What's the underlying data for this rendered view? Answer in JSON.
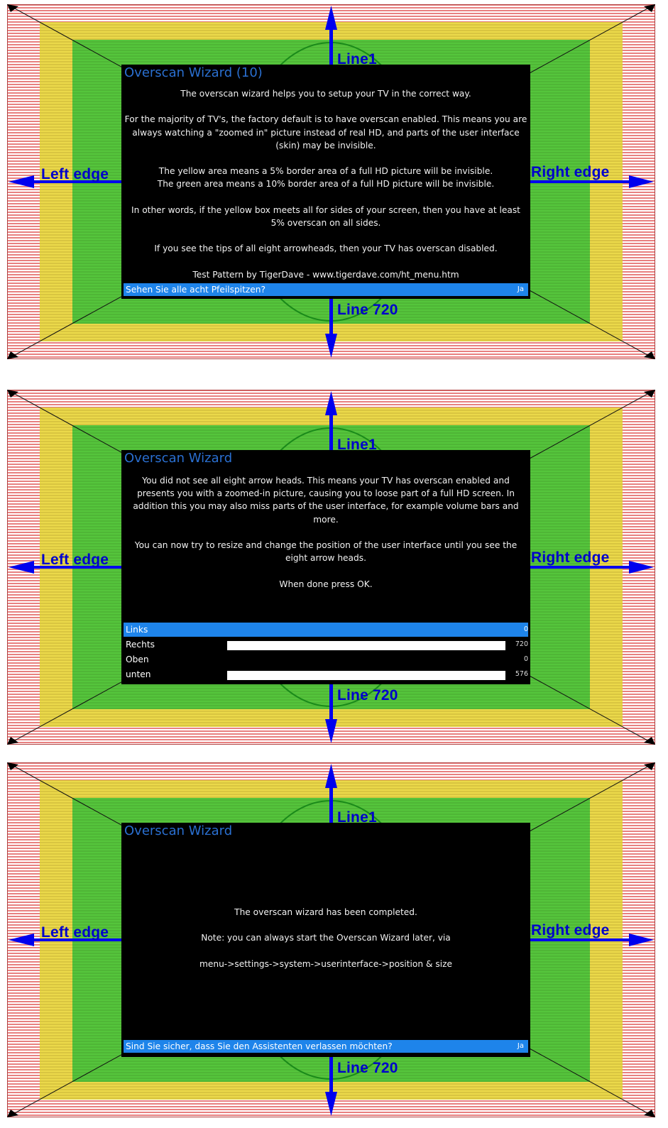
{
  "pattern": {
    "colors": {
      "red_stripes": "#e88080",
      "yellow": "#ebd94a",
      "green": "#55c53c",
      "arrow": "#0000ee"
    },
    "labels": {
      "top": "Line1",
      "bottom": "Line 720",
      "left": "Left edge",
      "right": "Right edge"
    }
  },
  "screens": [
    {
      "title": "Overscan Wizard (10)",
      "body": [
        "The overscan wizard helps you to setup your TV in the correct way.",
        "",
        "For the majority of TV's, the factory default is to have overscan enabled. This means you are always watching a \"zoomed in\" picture instead of real HD, and parts of the user interface (skin) may be invisible.",
        "",
        "The yellow area means a 5% border area of a full HD picture will be invisible.",
        "The green area means a 10% border area of a full HD picture will be invisible.",
        "",
        "In other words, if the yellow box meets all for sides of your screen, then you have at least 5% overscan on all sides.",
        "",
        "If you see the tips of all eight arrowheads, then your TV has overscan disabled.",
        "",
        "Test Pattern by TigerDave - www.tigerdave.com/ht_menu.htm"
      ],
      "question": {
        "text": "Sehen Sie alle acht Pfeilspitzen?",
        "value": "Ja"
      }
    },
    {
      "title": "Overscan Wizard",
      "body": [
        "You did not see all eight arrow heads. This means your TV has overscan enabled and presents you with a zoomed-in picture, causing you to loose part of a full HD screen. In addition this you may also miss parts of the user interface, for example volume bars and more.",
        "",
        "You can now try to resize and change the position of the user interface until you see the eight arrow heads.",
        "",
        "When done press OK."
      ],
      "settings": [
        {
          "label": "Links",
          "value": "0",
          "slider": false,
          "selected": true
        },
        {
          "label": "Rechts",
          "value": "720",
          "slider": true,
          "selected": false
        },
        {
          "label": "Oben",
          "value": "0",
          "slider": false,
          "selected": false
        },
        {
          "label": "unten",
          "value": "576",
          "slider": true,
          "selected": false
        }
      ]
    },
    {
      "title": "Overscan Wizard",
      "body": [
        "The overscan wizard has been completed.",
        "",
        "Note: you can always start the Overscan Wizard later,  via",
        "",
        "menu->settings->system->userinterface->position & size"
      ],
      "question": {
        "text": "Sind Sie sicher, dass Sie den Assistenten verlassen möchten?",
        "value": "Ja"
      }
    }
  ]
}
